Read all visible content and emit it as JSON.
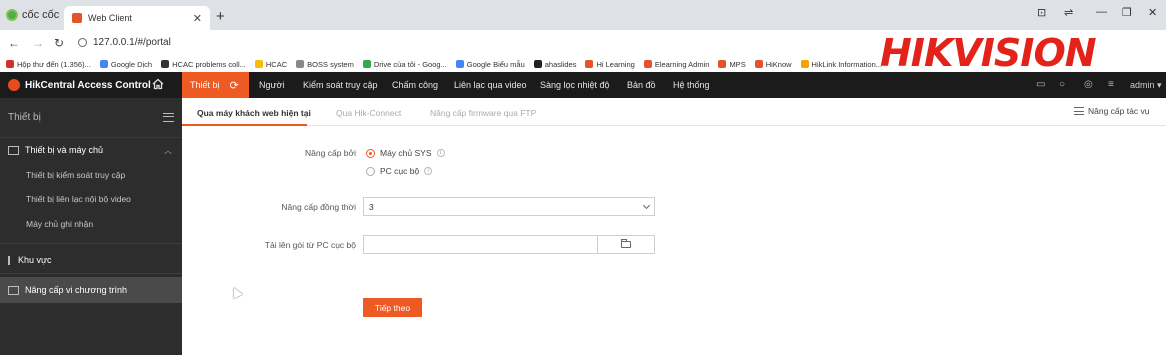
{
  "browser": {
    "brand": "cốc cốc",
    "tab_title": "Web Client",
    "url": "127.0.0.1/#/portal",
    "bookmarks": [
      {
        "label": "Hộp thư đến (1.356)...",
        "color": "#d93025"
      },
      {
        "label": "Google Dịch",
        "color": "#4285f4"
      },
      {
        "label": "HCAC problems coll...",
        "color": "#333333"
      },
      {
        "label": "HCAC",
        "color": "#fbbc04"
      },
      {
        "label": "BOSS system",
        "color": "#888888"
      },
      {
        "label": "Drive của tôi - Goog...",
        "color": "#34a853"
      },
      {
        "label": "Google Biểu mẫu",
        "color": "#4285f4"
      },
      {
        "label": "ahaslides",
        "color": "#222222"
      },
      {
        "label": "Hi Learning",
        "color": "#e5532b"
      },
      {
        "label": "Elearning Admin",
        "color": "#e5532b"
      },
      {
        "label": "MPS",
        "color": "#e5532b"
      },
      {
        "label": "HiKnow",
        "color": "#e5532b"
      },
      {
        "label": "HikLink Information...",
        "color": "#f4a300"
      }
    ]
  },
  "watermark": {
    "text": "HIKVISION"
  },
  "app": {
    "title": "HikCentral Access Control",
    "nav": {
      "active": "Thiết bị",
      "items": [
        "Người",
        "Kiểm soát truy cập",
        "Chấm công",
        "Liên lạc qua video",
        "Sàng lọc nhiệt độ",
        "Bản đồ",
        "Hệ thống"
      ]
    },
    "user": "admin"
  },
  "sidebar": {
    "title": "Thiết bị",
    "group1": "Thiết bị và máy chủ",
    "subitems": [
      "Thiết bị kiểm soát truy cập",
      "Thiết bị liên lạc nội bộ video",
      "Máy chủ ghi nhận"
    ],
    "group2": "Khu vực",
    "group3": "Nâng cấp vi chương trình"
  },
  "main": {
    "tabs": [
      "Qua máy khách web hiện tại",
      "Qua Hik-Connect",
      "Nâng cấp firmware qua FTP"
    ],
    "task_link": "Nâng cấp tác vụ",
    "upgrade_by_label": "Nâng cấp bởi",
    "options": [
      "Máy chủ SYS",
      "PC cục bộ"
    ],
    "concurrent_label": "Nâng cấp đồng thời",
    "concurrent_value": "3",
    "upload_label": "Tải lên gói từ PC cục bộ",
    "upload_value": "",
    "next_button": "Tiếp theo"
  },
  "colors": {
    "accent": "#ee5a24",
    "header": "#1b1b1b",
    "sidebar": "#2d2d2d"
  }
}
